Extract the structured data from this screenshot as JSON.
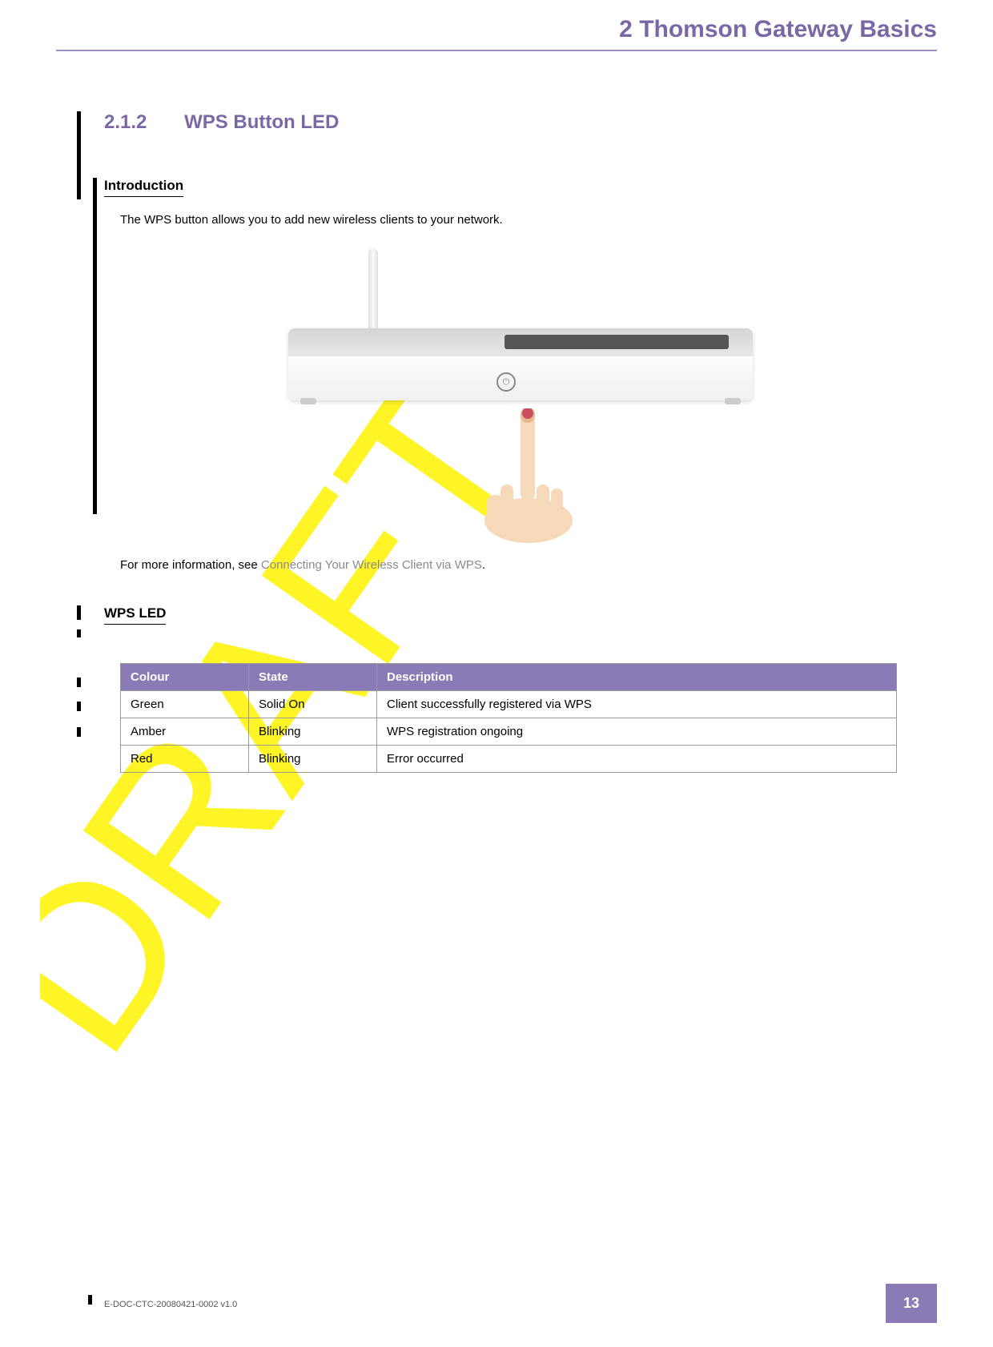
{
  "header": {
    "chapter_number": "2",
    "chapter_title": "Thomson Gateway Basics"
  },
  "section": {
    "number": "2.1.2",
    "title": "WPS Button LED"
  },
  "introduction": {
    "heading": "Introduction",
    "body": "The WPS button allows you to add new wireless clients to your network.",
    "more_info_prefix": "For more information, see ",
    "more_info_link": "Connecting Your Wireless Client via WPS",
    "more_info_suffix": "."
  },
  "wps_led": {
    "heading": "WPS LED",
    "table": {
      "headers": [
        "Colour",
        "State",
        "Description"
      ],
      "rows": [
        [
          "Green",
          "Solid On",
          "Client successfully registered via WPS"
        ],
        [
          "Amber",
          "Blinking",
          "WPS registration ongoing"
        ],
        [
          "Red",
          "Blinking",
          "Error occurred"
        ]
      ]
    }
  },
  "footer": {
    "doc_id": "E-DOC-CTC-20080421-0002 v1.0",
    "page_number": "13"
  },
  "watermark": "DRAFT"
}
